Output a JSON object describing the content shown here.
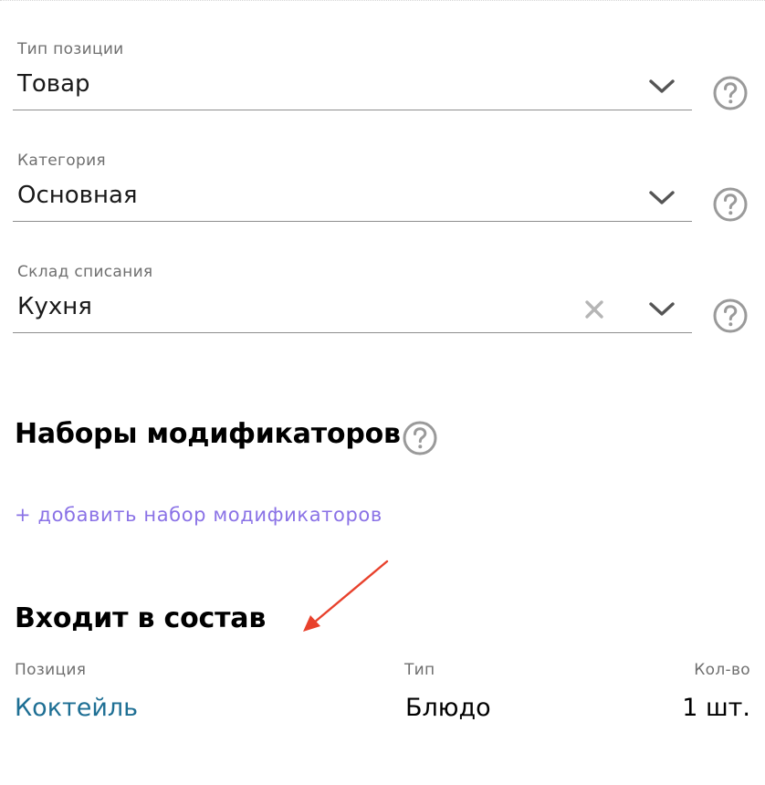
{
  "fields": [
    {
      "label": "Тип позиции",
      "value": "Товар",
      "has_clear": false
    },
    {
      "label": "Категория",
      "value": "Основная",
      "has_clear": false
    },
    {
      "label": "Склад списания",
      "value": "Кухня",
      "has_clear": true
    }
  ],
  "modifiers": {
    "title": "Наборы модификаторов",
    "add_link": "+ добавить набор модификаторов"
  },
  "composition": {
    "title": "Входит в состав",
    "columns": [
      "Позиция",
      "Тип",
      "Кол-во"
    ],
    "rows": [
      {
        "position": "Коктейль",
        "type": "Блюдо",
        "qty": "1 шт."
      }
    ]
  },
  "icons": {
    "dropdown": "chevron-down-icon",
    "clear": "clear-icon",
    "help": "help-icon",
    "annotation": "red-arrow-annotation"
  },
  "colors": {
    "link_purple": "#8a72e6",
    "link_blue": "#1e6f94",
    "label_gray": "#6f6f6f",
    "icon_gray": "#999999",
    "annotation_red": "#e8412c"
  }
}
